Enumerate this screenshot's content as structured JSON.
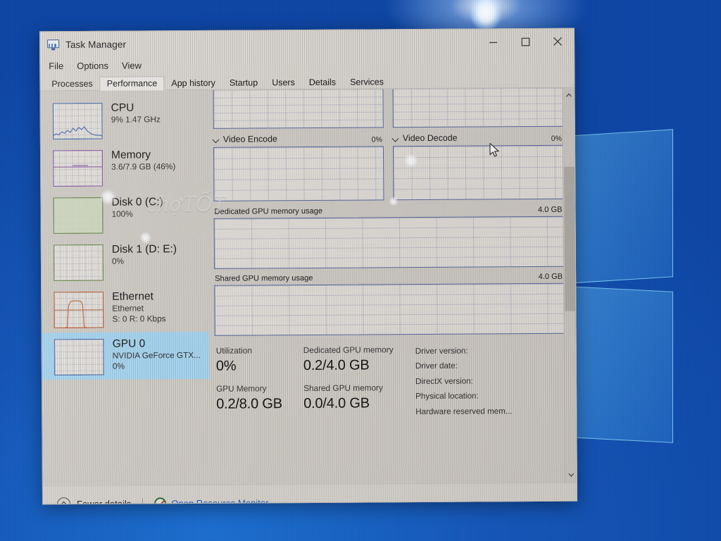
{
  "window": {
    "title": "Task Manager",
    "icon": "task-manager-icon",
    "controls": {
      "minimize": "minimize",
      "maximize": "maximize",
      "close": "close"
    }
  },
  "menu": {
    "items": [
      "File",
      "Options",
      "View"
    ]
  },
  "tabs": {
    "active": "Performance",
    "items": [
      "Processes",
      "Performance",
      "App history",
      "Startup",
      "Users",
      "Details",
      "Services"
    ]
  },
  "sidebar": {
    "items": [
      {
        "name": "CPU",
        "detail": "9%  1.47 GHz",
        "detail2": "",
        "selected": false,
        "accent": "#3b6ea8"
      },
      {
        "name": "Memory",
        "detail": "3.6/7.9 GB (46%)",
        "detail2": "",
        "selected": false,
        "accent": "#8a5fa8"
      },
      {
        "name": "Disk 0 (C:)",
        "detail": "100%",
        "detail2": "",
        "selected": false,
        "accent": "#5a8a4a"
      },
      {
        "name": "Disk 1 (D: E:)",
        "detail": "0%",
        "detail2": "",
        "selected": false,
        "accent": "#5a8a4a"
      },
      {
        "name": "Ethernet",
        "detail": "Ethernet",
        "detail2": "S: 0 R: 0 Kbps",
        "selected": false,
        "accent": "#b8603a"
      },
      {
        "name": "GPU 0",
        "detail": "NVIDIA GeForce GTX...",
        "detail2": "0%",
        "selected": true,
        "accent": "#3b6ea8"
      }
    ]
  },
  "gpu_panel": {
    "top_graphs": [
      {
        "label": "",
        "percent": ""
      },
      {
        "label": "",
        "percent": ""
      }
    ],
    "mid_graphs": [
      {
        "label": "Video Encode",
        "percent": "0%"
      },
      {
        "label": "Video Decode",
        "percent": "0%"
      }
    ],
    "memory_graphs": [
      {
        "label": "Dedicated GPU memory usage",
        "max": "4.0 GB"
      },
      {
        "label": "Shared GPU memory usage",
        "max": "4.0 GB"
      }
    ],
    "stats": {
      "col1": [
        {
          "caption": "Utilization",
          "value": "0%"
        },
        {
          "caption": "GPU Memory",
          "value": "0.2/8.0 GB"
        }
      ],
      "col2": [
        {
          "caption": "Dedicated GPU memory",
          "value": "0.2/4.0 GB"
        },
        {
          "caption": "Shared GPU memory",
          "value": "0.0/4.0 GB"
        }
      ],
      "driver_info": [
        "Driver version:",
        "Driver date:",
        "DirectX version:",
        "Physical location:",
        "Hardware reserved mem..."
      ]
    }
  },
  "footer": {
    "fewer_details": "Fewer details",
    "open_resource_monitor": "Open Resource Monitor"
  },
  "watermark": {
    "text": "chợTỐT"
  },
  "colors": {
    "selection": "#a7d4ef",
    "link": "#1a58c0",
    "window_bg": "#d7d3cd",
    "desktop": "#1356b6"
  }
}
